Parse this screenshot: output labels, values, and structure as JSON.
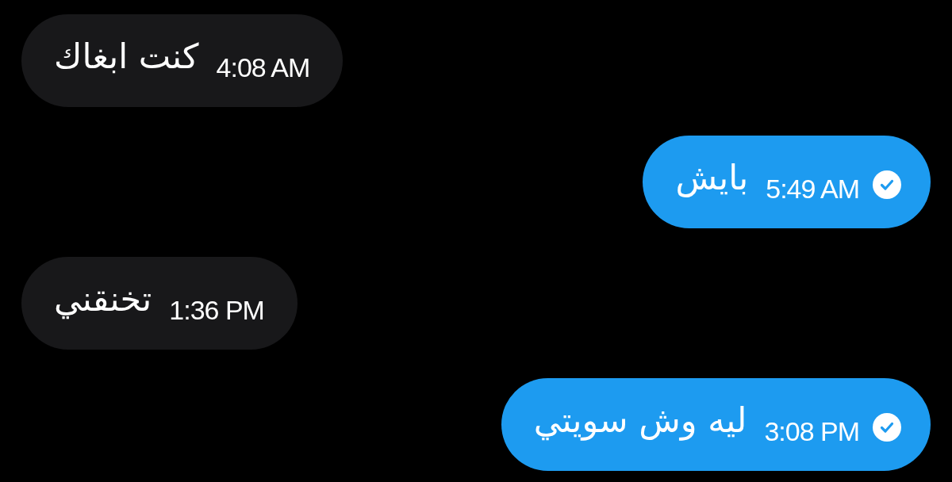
{
  "messages": [
    {
      "kind": "received",
      "text": "كنت ابغاك",
      "time": "4:08 AM",
      "read": false
    },
    {
      "kind": "sent",
      "text": "بايش",
      "time": "5:49 AM",
      "read": true
    },
    {
      "kind": "received",
      "text": "تخنقني",
      "time": "1:36 PM",
      "read": false
    },
    {
      "kind": "sent",
      "text": "ليه وش سويتي",
      "time": "3:08 PM",
      "read": true
    }
  ]
}
